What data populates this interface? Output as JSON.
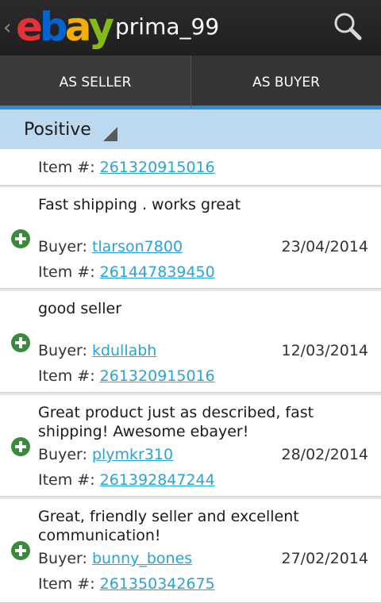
{
  "header": {
    "up_glyph": "‹",
    "logo": {
      "e": "e",
      "b": "b",
      "a": "a",
      "y": "y"
    },
    "title": "prima_99",
    "search_icon": "search-icon"
  },
  "tabs": [
    {
      "label": "AS SELLER",
      "selected": true
    },
    {
      "label": "AS BUYER",
      "selected": false
    }
  ],
  "filter": {
    "label": "Positive"
  },
  "labels": {
    "buyer": "Buyer:",
    "item": "Item #:"
  },
  "feedback": [
    {
      "comment": "",
      "buyer": "",
      "date": "",
      "item": "261320915016"
    },
    {
      "comment": "Fast shipping . works great",
      "buyer": "tlarson7800",
      "date": "23/04/2014",
      "item": "261447839450"
    },
    {
      "comment": "good seller",
      "buyer": "kdullabh",
      "date": "12/03/2014",
      "item": "261320915016"
    },
    {
      "comment": "Great product just as described, fast shipping! Awesome ebayer!",
      "buyer": "plymkr310",
      "date": "28/02/2014",
      "item": "261392847244"
    },
    {
      "comment": "Great, friendly seller and excellent communication!",
      "buyer": "bunny_bones",
      "date": "27/02/2014",
      "item": "261350342675"
    }
  ],
  "colors": {
    "accent": "#2c8fd6",
    "link": "#2ba3d7",
    "positive": "#3a8a3e",
    "filter_bg": "#bcd9ef"
  }
}
